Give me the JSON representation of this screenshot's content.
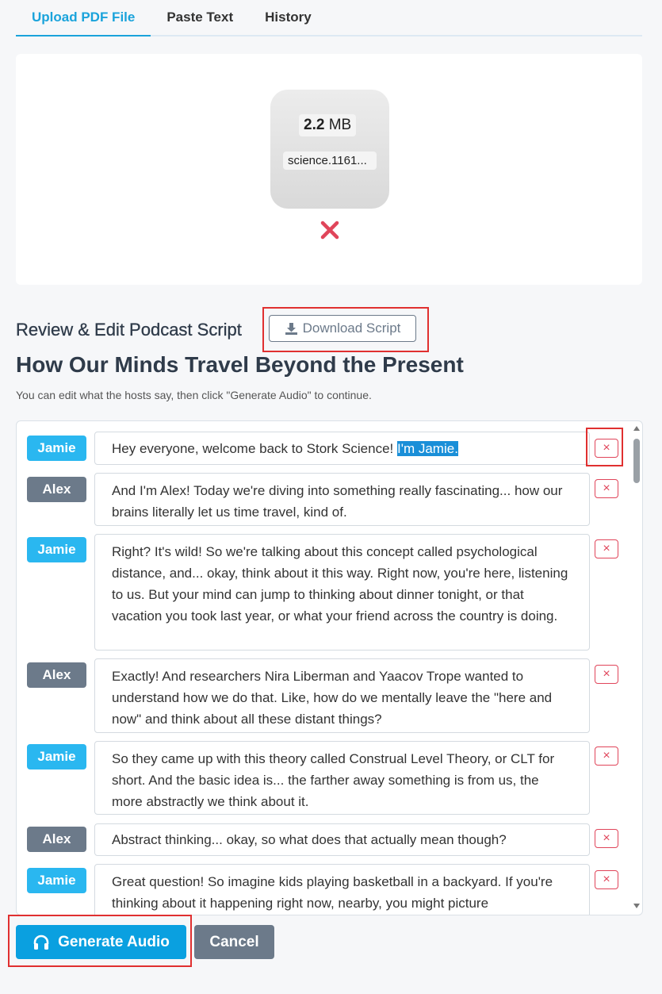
{
  "tabs": [
    {
      "label": "Upload PDF File",
      "active": true
    },
    {
      "label": "Paste Text",
      "active": false
    },
    {
      "label": "History",
      "active": false
    }
  ],
  "upload": {
    "size_number": "2.2",
    "size_unit": "MB",
    "file_name": "science.1161..."
  },
  "review": {
    "heading": "Review & Edit Podcast Script",
    "download_label": "Download Script",
    "podcast_title": "How Our Minds Travel Beyond the Present",
    "hint": "You can edit what the hosts say, then click \"Generate Audio\" to continue."
  },
  "script": [
    {
      "speaker": "Jamie",
      "text": "Hey everyone, welcome back to Stork Science! ",
      "selected": "I'm Jamie."
    },
    {
      "speaker": "Alex",
      "text": "And I'm Alex! Today we're diving into something really fascinating... how our brains literally let us time travel, kind of."
    },
    {
      "speaker": "Jamie",
      "text": "Right? It's wild! So we're talking about this concept called psychological distance, and... okay, think about it this way. Right now, you're here, listening to us. But your mind can jump to thinking about dinner tonight, or that vacation you took last year, or what your friend across the country is doing."
    },
    {
      "speaker": "Alex",
      "text": "Exactly! And researchers Nira Liberman and Yaacov Trope wanted to understand how we do that. Like, how do we mentally leave the \"here and now\" and think about all these distant things?"
    },
    {
      "speaker": "Jamie",
      "text": "So they came up with this theory called Construal Level Theory, or CLT for short. And the basic idea is... the farther away something is from us, the more abstractly we think about it."
    },
    {
      "speaker": "Alex",
      "text": "Abstract thinking... okay, so what does that actually mean though?"
    },
    {
      "speaker": "Jamie",
      "text": "Great question! So imagine kids playing basketball in a backyard. If you're thinking about it happening right now, nearby, you might picture"
    }
  ],
  "delete_symbol": "×",
  "actions": {
    "generate_label": "Generate Audio",
    "cancel_label": "Cancel"
  },
  "colors": {
    "accent": "#1aa3db",
    "jamie": "#2ab7f0",
    "alex": "#6c7a8a",
    "danger": "#e0455a"
  }
}
